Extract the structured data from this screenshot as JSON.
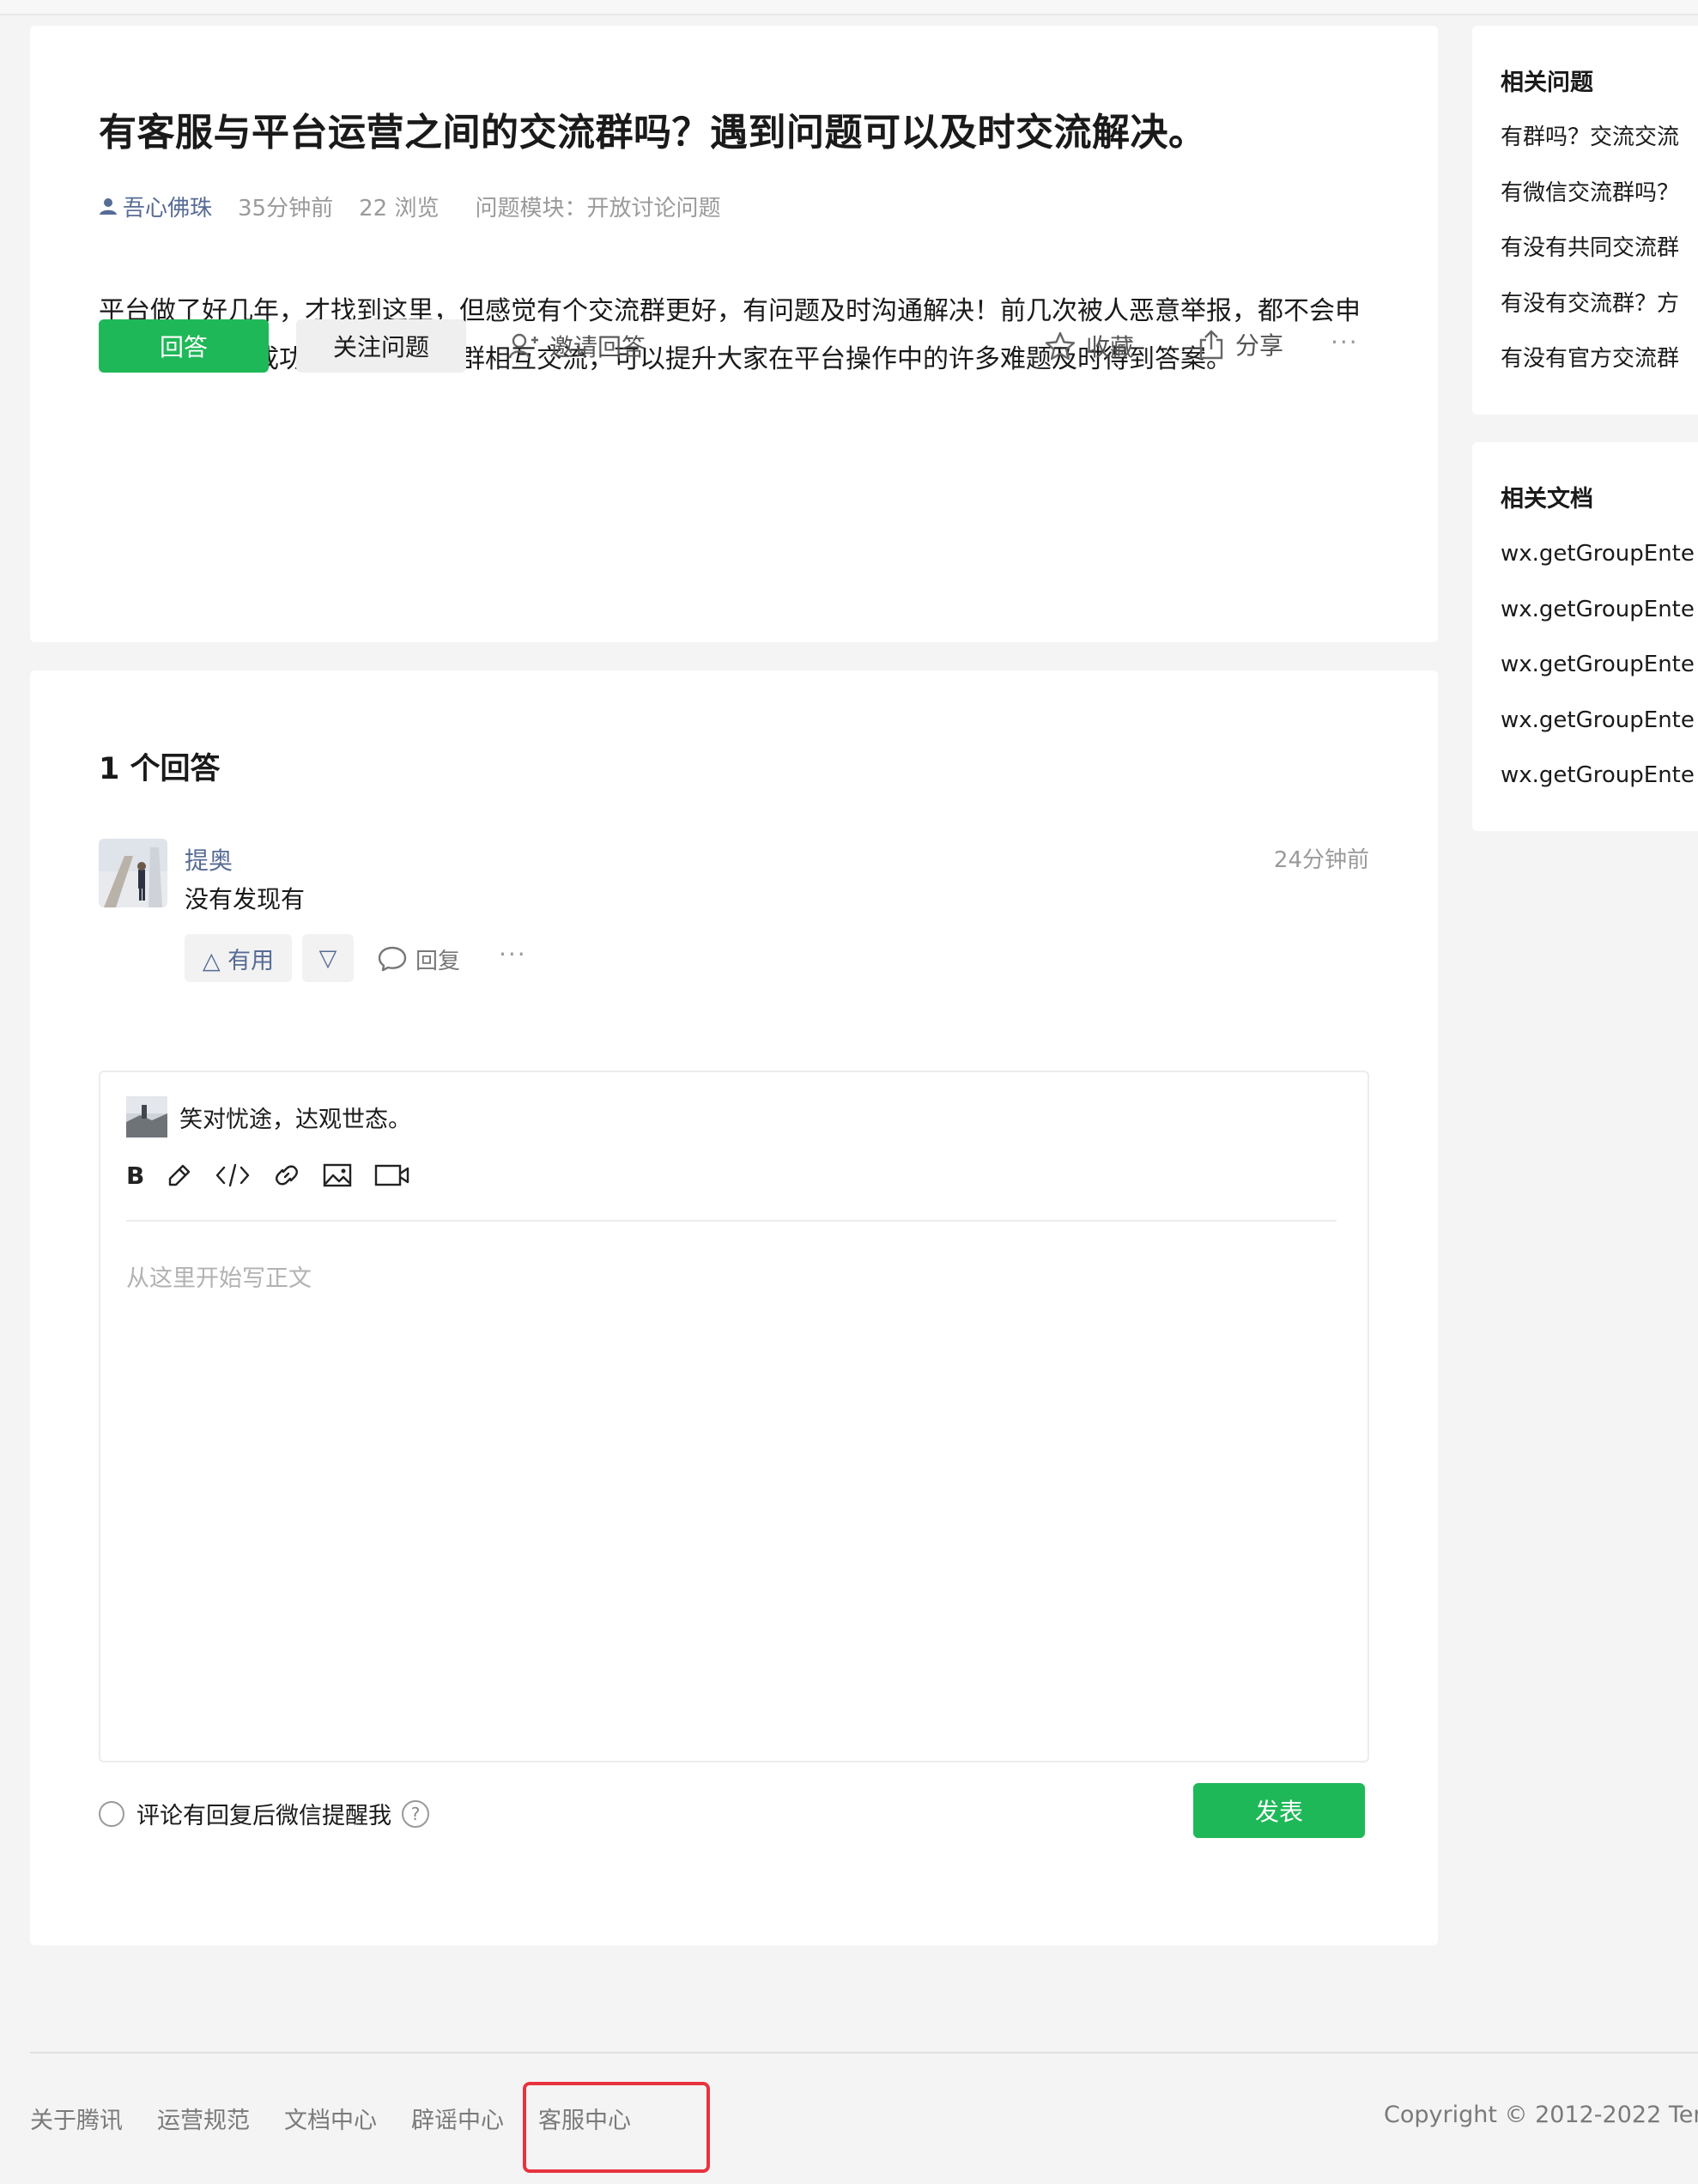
{
  "question": {
    "title": "有客服与平台运营之间的交流群吗？遇到问题可以及时交流解决。",
    "author": "吾心佛珠",
    "time": "35分钟前",
    "views": "22 浏览",
    "module_label": "问题模块：",
    "module_value": "开放讨论问题",
    "body": "平台做了好几年，才找到这里，但感觉有个交流群更好，有问题及时沟通解决！前几次被人恶意举报，都不会申诉，之后申诉成功两次，如果有群相互交流，可以提升大家在平台操作中的许多难题及时得到答案。",
    "actions": {
      "answer": "回答",
      "follow": "关注问题",
      "invite": "邀请回答",
      "collect": "收藏",
      "share": "分享",
      "more": "···"
    }
  },
  "answers": {
    "count_label": "1 个回答",
    "items": [
      {
        "user": "提奥",
        "time": "24分钟前",
        "text": "没有发现有",
        "useful_label": "△ 有用",
        "down_label": "▽",
        "reply_label": "回复",
        "more": "···"
      }
    ]
  },
  "editor": {
    "user": "笑对忧途，达观世态。",
    "bold_label": "B",
    "placeholder": "从这里开始写正文",
    "notify_label": "评论有回复后微信提醒我",
    "help_label": "?",
    "submit": "发表"
  },
  "sidebar": {
    "related_questions": {
      "title": "相关问题",
      "items": [
        "有群吗？交流交流",
        "有微信交流群吗？",
        "有没有共同交流群",
        "有没有交流群？方",
        "有没有官方交流群"
      ]
    },
    "related_docs": {
      "title": "相关文档",
      "items": [
        "wx.getGroupEnte",
        "wx.getGroupEnte",
        "wx.getGroupEnte",
        "wx.getGroupEnte",
        "wx.getGroupEnte"
      ]
    }
  },
  "footer": {
    "links": [
      "关于腾讯",
      "运营规范",
      "文档中心",
      "辟谣中心",
      "客服中心"
    ],
    "copyright": "Copyright © 2012-2022 Ter"
  },
  "colors": {
    "accent_green": "#1fb858",
    "link_blue": "#576b95",
    "highlight_red": "#e8333f"
  }
}
